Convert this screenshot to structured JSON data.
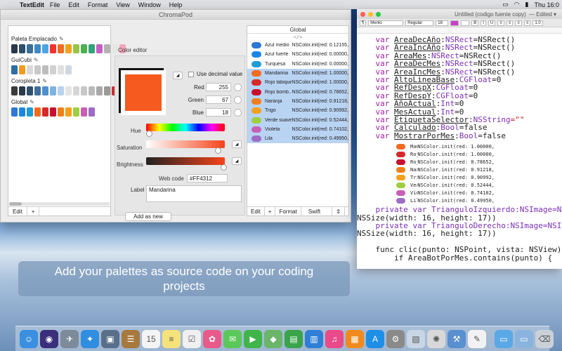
{
  "menubar": {
    "apple": "",
    "app": "TextEdit",
    "items": [
      "File",
      "Edit",
      "Format",
      "View",
      "Window",
      "Help"
    ],
    "clock": "Thu 16:0"
  },
  "chromapod": {
    "title": "ChromaPod",
    "palettes": [
      {
        "name": "Paleta Emplacado",
        "colors": [
          "#2b3a4a",
          "#2f4f6a",
          "#3a6e95",
          "#3e88c7",
          "#4aa6e0",
          "#f4312f",
          "#f26b21",
          "#f3a01c",
          "#9bc34a",
          "#49b152",
          "#34a37a",
          "#c75ec7",
          "#b3b3b3",
          "#e6e6e6",
          "#f2a7b9"
        ]
      },
      {
        "name": "GuiCubi",
        "colors": [
          "#2f6da8",
          "#f29c1c",
          "#d9d9d9",
          "#c8c8c8",
          "#bdbdbd",
          "#d0d0d0",
          "#e0e0e0",
          "#cfd8e0"
        ]
      },
      {
        "name": "Coropleta 1",
        "colors": [
          "#3a3a3a",
          "#2b3a4a",
          "#2f4f6a",
          "#3e6f9a",
          "#4f8fcb",
          "#7fb2e0",
          "#b8d3ef",
          "#e5e5e5",
          "#d6d6d6",
          "#c8c8c8",
          "#bababa",
          "#a9a9a9",
          "#9a9a9a",
          "#cd2b35",
          "#f4f4f4"
        ]
      },
      {
        "name": "Global",
        "colors": [
          "#2f78d6",
          "#1c86e8",
          "#1f9bd6",
          "#f26b21",
          "#d62a2a",
          "#c8102e",
          "#ee7f1a",
          "#f3a01c",
          "#9fcf3e",
          "#c85fb4",
          "#9d6cc4"
        ]
      }
    ],
    "left_bottom": {
      "edit": "Edit",
      "add": "+"
    },
    "editor": {
      "title": "Color editor",
      "use_decimal": "Use decimal value",
      "red_label": "Red",
      "red": "255",
      "green_label": "Green",
      "green": "67",
      "blue_label": "Blue",
      "blue": "18",
      "hue_label": "Hue",
      "saturation_label": "Saturation",
      "brightness_label": "Brightness",
      "webcode_label": "Web code",
      "webcode": "#FF4312",
      "label_label": "Label",
      "label_value": "Mandarina",
      "add_button": "Add as new",
      "swatch_color": "#f65a1e"
    },
    "global": {
      "header": "Global",
      "code_icon": "</>",
      "rows": [
        {
          "name": "Azul medio",
          "value": "NSColor.init(red: 0.12155,",
          "color": "#2f78d6",
          "selected": false
        },
        {
          "name": "Azul fuerte",
          "value": "NSColor.init(red: 0.00000,",
          "color": "#1c86e8",
          "selected": false
        },
        {
          "name": "Turquesa",
          "value": "NSColor.init(red: 0.00000,",
          "color": "#1f9bd6",
          "selected": false
        },
        {
          "name": "Mandarina",
          "value": "NSColor.init(red: 1.00000,",
          "color": "#f26b21",
          "selected": true
        },
        {
          "name": "Rojo tabique",
          "value": "NSColor.init(red: 1.00000,",
          "color": "#d62a2a",
          "selected": true
        },
        {
          "name": "Rojo bomb...",
          "value": "NSColor.init(red: 0.78652,",
          "color": "#c8102e",
          "selected": true
        },
        {
          "name": "Naranja",
          "value": "NSColor.init(red: 0.91218,",
          "color": "#ee7f1a",
          "selected": true
        },
        {
          "name": "Trigo",
          "value": "NSColor.init(red: 0.90992,",
          "color": "#f3a01c",
          "selected": true
        },
        {
          "name": "Verde suave",
          "value": "NSColor.init(red: 0.52444,",
          "color": "#9fcf3e",
          "selected": true
        },
        {
          "name": "Violeta",
          "value": "NSColor.init(red: 0.74102,",
          "color": "#c85fb4",
          "selected": true
        },
        {
          "name": "Lila",
          "value": "NSColor.init(red: 0.49950,",
          "color": "#9d6cc4",
          "selected": true
        }
      ],
      "bottom": {
        "edit": "Edit",
        "add": "+",
        "format": "Format",
        "format_value": "Swift RGB"
      }
    }
  },
  "textedit": {
    "title": "Untitled (codigo fuente copy)",
    "edited": "— Edited ▾",
    "toolbar": {
      "style": "Menlo",
      "weight": "Regular",
      "size": "18",
      "spacing": "1.0"
    },
    "code_lines": [
      {
        "pre": "    ",
        "kw": "var ",
        "name": "AreaDecAño",
        "rest": ":",
        "ty": "NSRect",
        "tail": "=NSRect()"
      },
      {
        "pre": "    ",
        "kw": "var ",
        "name": "AreaIncAño",
        "rest": ":",
        "ty": "NSRect",
        "tail": "=NSRect()"
      },
      {
        "pre": "    ",
        "kw": "var ",
        "name": "AreaMes",
        "rest": ":",
        "ty": "NSRect",
        "tail": "=NSRect()"
      },
      {
        "pre": "    ",
        "kw": "var ",
        "name": "AreaDecMes",
        "rest": ":",
        "ty": "NSRect",
        "tail": "=NSRect()"
      },
      {
        "pre": "    ",
        "kw": "var ",
        "name": "AreaIncMes",
        "rest": ":",
        "ty": "NSRect",
        "tail": "=NSRect()"
      },
      {
        "pre": "    ",
        "kw": "var ",
        "name": "AltoLineaBase",
        "rest": ":",
        "ty": "CGFloat",
        "tail": "=0"
      },
      {
        "pre": "    ",
        "kw": "var ",
        "name": "RefDespX",
        "rest": ":",
        "ty": "CGFloat",
        "tail": "=0"
      },
      {
        "pre": "    ",
        "kw": "var ",
        "name": "RefDespY",
        "rest": ":",
        "ty": "CGFloat",
        "tail": "=0"
      },
      {
        "pre": "    ",
        "kw": "var ",
        "name": "AñoActual",
        "rest": ":",
        "ty": "Int",
        "tail": "=0"
      },
      {
        "pre": "    ",
        "kw": "var ",
        "name": "MesActual",
        "rest": ":",
        "ty": "Int",
        "tail": "=0"
      },
      {
        "pre": "    ",
        "kw": "var ",
        "name": "EtiquetaSelector",
        "rest": ":",
        "ty": "NSString",
        "tail": "=\"\""
      },
      {
        "pre": "    ",
        "kw": "var ",
        "name": "Calculado",
        "rest": ":",
        "ty": "Bool",
        "tail": "=false"
      },
      {
        "pre": "    ",
        "kw": "var ",
        "name": "MostrarPorMes",
        "rest": ":",
        "ty": "Bool",
        "tail": "=false"
      }
    ],
    "embedded_rows": [
      {
        "name": "Mandarina",
        "value": "NSColor.init(red: 1.00000,",
        "color": "#f26b21"
      },
      {
        "name": "Rojo tabique",
        "value": "NSColor.init(red: 1.00000,",
        "color": "#d62a2a"
      },
      {
        "name": "Rojo bomb...",
        "value": "NSColor.init(red: 0.78652,",
        "color": "#c8102e"
      },
      {
        "name": "Naranja",
        "value": "NSColor.init(red: 0.91218,",
        "color": "#ee7f1a"
      },
      {
        "name": "Trigo",
        "value": "NSColor.init(red: 0.90992,",
        "color": "#f3a01c"
      },
      {
        "name": "Verde suave",
        "value": "NSColor.init(red: 0.52444,",
        "color": "#9fcf3e"
      },
      {
        "name": "Violeta",
        "value": "NSColor.init(red: 0.74102,",
        "color": "#c85fb4"
      },
      {
        "name": "Lila",
        "value": "NSColor.init(red: 0.49950,",
        "color": "#9d6cc4"
      }
    ],
    "tail_lines": [
      "    private var TrianguloIzquierdo:NSImage=NSI",
      "NSSize(width: 16, height: 17))",
      "    private var TrianguloDerecho:NSImage=NSI",
      "NSSize(width: 16, height: 17))",
      "",
      "    func clic(punto: NSPoint, vista: NSView)",
      "        if AreaBotPorMes.contains(punto) {"
    ]
  },
  "caption": {
    "line1": "Add your palettes as source code on your coding",
    "line2": "projects"
  },
  "dock": {
    "apps": [
      {
        "icon": "finder-icon",
        "color": "#3a8fe0",
        "glyph": "☺"
      },
      {
        "icon": "siri-icon",
        "color": "#3b2f7a",
        "glyph": "◉"
      },
      {
        "icon": "launchpad-icon",
        "color": "#7d8a9a",
        "glyph": "✈"
      },
      {
        "icon": "safari-icon",
        "color": "#2f8ee0",
        "glyph": "✦"
      },
      {
        "icon": "photos-edit-icon",
        "color": "#5a6f8a",
        "glyph": "▣"
      },
      {
        "icon": "contacts-icon",
        "color": "#a8793f",
        "glyph": "☰"
      },
      {
        "icon": "calendar-icon",
        "color": "#f4f4f4",
        "glyph": "15"
      },
      {
        "icon": "notes-icon",
        "color": "#f6e27a",
        "glyph": "≡"
      },
      {
        "icon": "reminders-icon",
        "color": "#f0f0f0",
        "glyph": "☑"
      },
      {
        "icon": "photos-icon",
        "color": "#e85a8a",
        "glyph": "✿"
      },
      {
        "icon": "messages-icon",
        "color": "#5ac85a",
        "glyph": "✉"
      },
      {
        "icon": "facetime-icon",
        "color": "#3fb54a",
        "glyph": "▶"
      },
      {
        "icon": "maps-icon",
        "color": "#6bb56b",
        "glyph": "◆"
      },
      {
        "icon": "numbers-icon",
        "color": "#3aa44a",
        "glyph": "▤"
      },
      {
        "icon": "keynote-icon",
        "color": "#2f7fd6",
        "glyph": "▥"
      },
      {
        "icon": "itunes-icon",
        "color": "#e94a8a",
        "glyph": "♫"
      },
      {
        "icon": "ibooks-icon",
        "color": "#f08a1e",
        "glyph": "▦"
      },
      {
        "icon": "appstore-icon",
        "color": "#1f8fe6",
        "glyph": "A"
      },
      {
        "icon": "system-preferences-icon",
        "color": "#8a8a8a",
        "glyph": "⚙"
      },
      {
        "icon": "preview-icon",
        "color": "#c9d6e6",
        "glyph": "▧"
      },
      {
        "icon": "chromapod-icon",
        "color": "#d8d8d8",
        "glyph": "✺"
      },
      {
        "icon": "xcode-icon",
        "color": "#5a8fd0",
        "glyph": "⚒"
      },
      {
        "icon": "textedit-icon",
        "color": "#f2f2f2",
        "glyph": "✎"
      }
    ],
    "right": [
      {
        "icon": "folder-icon",
        "color": "#5aa8e6",
        "glyph": "▭"
      },
      {
        "icon": "downloads-icon",
        "color": "#8ab4de",
        "glyph": "▭"
      },
      {
        "icon": "trash-icon",
        "color": "#c9d0d8",
        "glyph": "⌫"
      }
    ]
  }
}
